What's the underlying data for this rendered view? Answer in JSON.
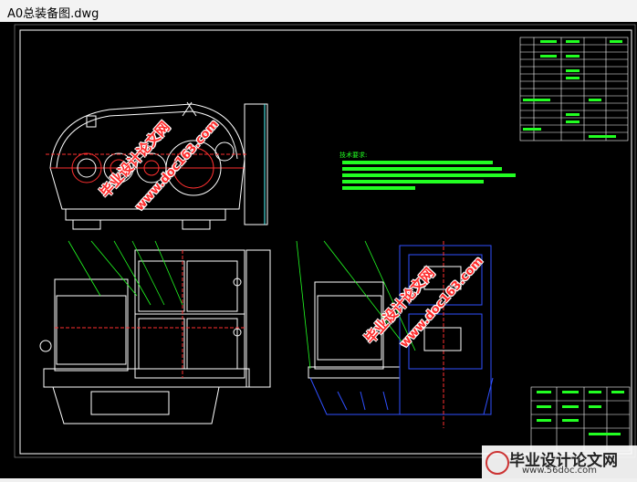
{
  "window": {
    "title": "A0总装备图.dwg"
  },
  "drawing": {
    "notes_heading": "技术要求:",
    "colors": {
      "frame": "#ffffff",
      "primary": "#ffffff",
      "red": "#ff3030",
      "green": "#22ff22",
      "blue": "#3050ff"
    }
  },
  "watermarks": {
    "site_cn": "毕业设计论文网",
    "site_en": "www.doc163.com",
    "footer_cn": "毕业设计论文网",
    "footer_en": "www.56doc.com"
  }
}
